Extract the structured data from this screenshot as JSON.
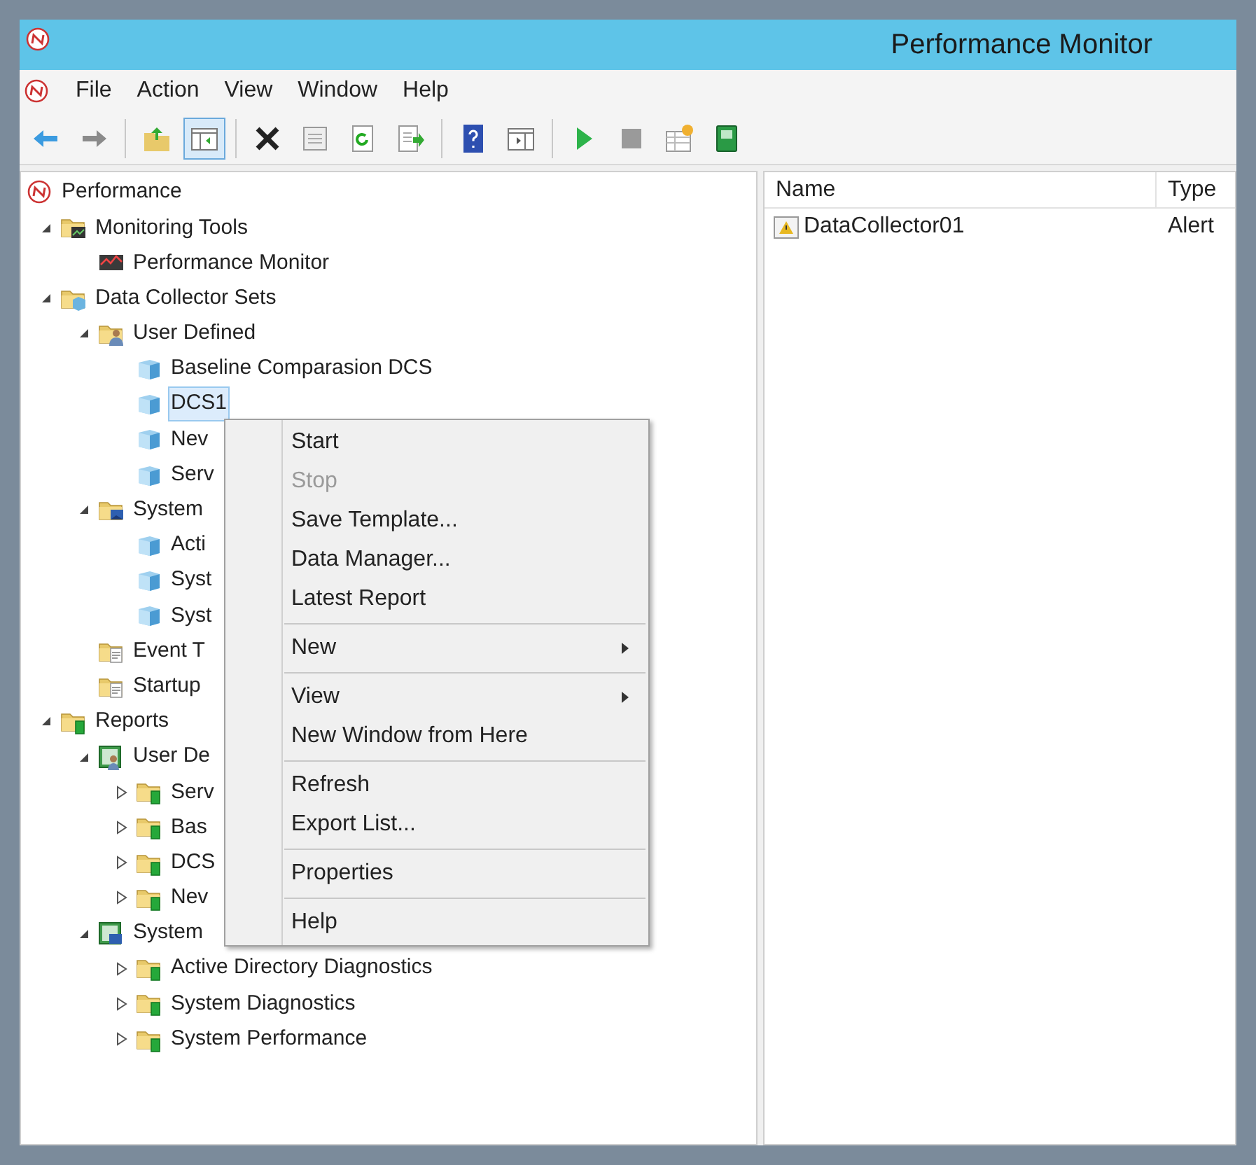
{
  "window": {
    "title": "Performance Monitor"
  },
  "menu_bar": [
    "File",
    "Action",
    "View",
    "Window",
    "Help"
  ],
  "toolbar": [
    {
      "kind": "back",
      "pressed": false
    },
    {
      "kind": "forward",
      "pressed": false
    },
    {
      "kind": "separator"
    },
    {
      "kind": "up",
      "pressed": false
    },
    {
      "kind": "tree",
      "pressed": true
    },
    {
      "kind": "separator"
    },
    {
      "kind": "delete",
      "pressed": false
    },
    {
      "kind": "properties",
      "pressed": false
    },
    {
      "kind": "refresh",
      "pressed": false
    },
    {
      "kind": "export",
      "pressed": false
    },
    {
      "kind": "separator"
    },
    {
      "kind": "help",
      "pressed": false
    },
    {
      "kind": "actionpane",
      "pressed": false
    },
    {
      "kind": "separator"
    },
    {
      "kind": "play",
      "pressed": false
    },
    {
      "kind": "stop",
      "pressed": false
    },
    {
      "kind": "new",
      "pressed": false
    },
    {
      "kind": "book",
      "pressed": false
    }
  ],
  "tree": [
    {
      "label": "Performance",
      "kind": "perf",
      "selected": false,
      "children": [
        {
          "label": "Monitoring Tools",
          "kind": "folder-chart",
          "expanded": true,
          "selected": false,
          "children": [
            {
              "label": "Performance Monitor",
              "kind": "monitor",
              "selected": false
            }
          ]
        },
        {
          "label": "Data Collector Sets",
          "kind": "folder-dcs",
          "expanded": true,
          "selected": false,
          "children": [
            {
              "label": "User Defined",
              "kind": "folder-user",
              "expanded": true,
              "selected": false,
              "children": [
                {
                  "label": "Baseline Comparasion DCS",
                  "kind": "cube",
                  "selected": false
                },
                {
                  "label": "DCS1",
                  "kind": "cube",
                  "selected": true
                },
                {
                  "label": "Nev",
                  "kind": "cube",
                  "selected": false
                },
                {
                  "label": "Serv",
                  "kind": "cube",
                  "selected": false
                }
              ]
            },
            {
              "label": "System",
              "kind": "folder-system",
              "expanded": true,
              "selected": false,
              "children": [
                {
                  "label": "Acti",
                  "kind": "cube",
                  "selected": false
                },
                {
                  "label": "Syst",
                  "kind": "cube",
                  "selected": false
                },
                {
                  "label": "Syst",
                  "kind": "cube",
                  "selected": false
                }
              ]
            },
            {
              "label": "Event T",
              "kind": "folder-trace",
              "selected": false
            },
            {
              "label": "Startup",
              "kind": "folder-trace",
              "selected": false
            }
          ]
        },
        {
          "label": "Reports",
          "kind": "folder-report",
          "expanded": true,
          "selected": false,
          "children": [
            {
              "label": "User De",
              "kind": "report-user",
              "expanded": true,
              "selected": false,
              "children": [
                {
                  "label": "Serv",
                  "kind": "folder-report",
                  "expanded": false,
                  "selected": false
                },
                {
                  "label": "Bas",
                  "kind": "folder-report",
                  "expanded": false,
                  "selected": false
                },
                {
                  "label": "DCS",
                  "kind": "folder-report",
                  "expanded": false,
                  "selected": false
                },
                {
                  "label": "Nev",
                  "kind": "folder-report",
                  "expanded": false,
                  "selected": false
                }
              ]
            },
            {
              "label": "System",
              "kind": "report-system",
              "expanded": true,
              "selected": false,
              "children": [
                {
                  "label": "Active Directory Diagnostics",
                  "kind": "folder-report",
                  "expanded": false,
                  "selected": false
                },
                {
                  "label": "System Diagnostics",
                  "kind": "folder-report",
                  "expanded": false,
                  "selected": false
                },
                {
                  "label": "System Performance",
                  "kind": "folder-report",
                  "expanded": false,
                  "selected": false
                }
              ]
            }
          ]
        }
      ]
    }
  ],
  "list": {
    "columns": [
      "Name",
      "Type"
    ],
    "rows": [
      {
        "name": "DataCollector01",
        "type": "Alert"
      }
    ]
  },
  "context_menu": [
    {
      "label": "Start",
      "disabled": false,
      "submenu": false
    },
    {
      "label": "Stop",
      "disabled": true,
      "submenu": false
    },
    {
      "label": "Save Template...",
      "disabled": false,
      "submenu": false
    },
    {
      "label": "Data Manager...",
      "disabled": false,
      "submenu": false
    },
    {
      "label": "Latest Report",
      "disabled": false,
      "submenu": false
    },
    {
      "kind": "separator"
    },
    {
      "label": "New",
      "disabled": false,
      "submenu": true
    },
    {
      "kind": "separator"
    },
    {
      "label": "View",
      "disabled": false,
      "submenu": true
    },
    {
      "label": "New Window from Here",
      "disabled": false,
      "submenu": false
    },
    {
      "kind": "separator"
    },
    {
      "label": "Refresh",
      "disabled": false,
      "submenu": false
    },
    {
      "label": "Export List...",
      "disabled": false,
      "submenu": false
    },
    {
      "kind": "separator"
    },
    {
      "label": "Properties",
      "disabled": false,
      "submenu": false
    },
    {
      "kind": "separator"
    },
    {
      "label": "Help",
      "disabled": false,
      "submenu": false
    }
  ]
}
